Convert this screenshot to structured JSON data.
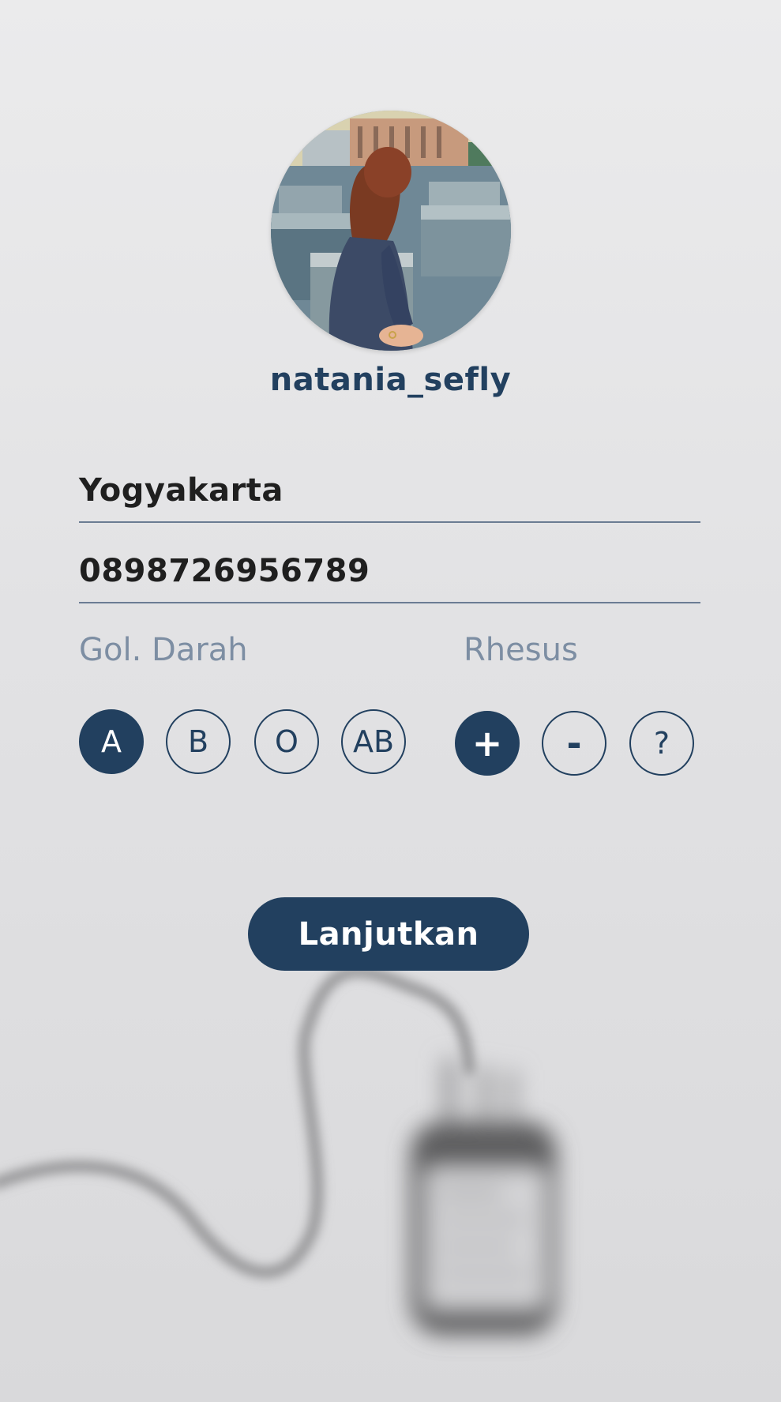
{
  "profile": {
    "username": "natania_sefly",
    "avatar_icon": "profile-photo"
  },
  "form": {
    "city_value": "Yogyakarta",
    "phone_value": "0898726956789"
  },
  "blood_type": {
    "label": "Gol. Darah",
    "options": [
      "A",
      "B",
      "O",
      "AB"
    ],
    "selected": "A"
  },
  "rhesus": {
    "label": "Rhesus",
    "options": [
      "+",
      "-",
      "?"
    ],
    "selected": "+"
  },
  "actions": {
    "continue_label": "Lanjutkan"
  },
  "colors": {
    "primary": "#22405f",
    "label_muted": "#7d8ea3",
    "background": "#e4e4e6"
  }
}
